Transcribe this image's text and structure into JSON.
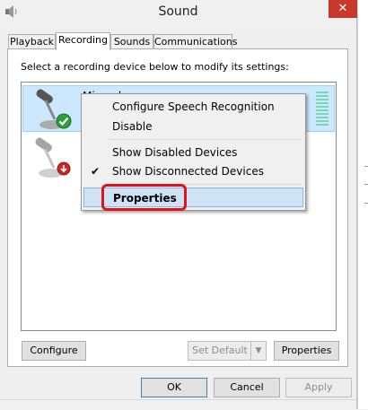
{
  "window": {
    "title": "Sound",
    "close_label": "✕"
  },
  "tabs": [
    {
      "label": "Playback",
      "active": false
    },
    {
      "label": "Recording",
      "active": true
    },
    {
      "label": "Sounds",
      "active": false
    },
    {
      "label": "Communications",
      "active": false
    }
  ],
  "instruction": "Select a recording device below to modify its settings:",
  "devices": [
    {
      "name": "Microphone",
      "icon": "microphone-icon",
      "status": "default-device",
      "selected": true
    },
    {
      "name": "",
      "icon": "microphone-icon",
      "status": "disconnected",
      "selected": false
    }
  ],
  "context_menu": {
    "items": [
      {
        "label": "Configure Speech Recognition",
        "checked": false
      },
      {
        "label": "Disable",
        "checked": false
      },
      {
        "label": "Show Disabled Devices",
        "checked": false
      },
      {
        "label": "Show Disconnected Devices",
        "checked": true
      },
      {
        "label": "Properties",
        "highlighted": true
      }
    ],
    "check_glyph": "✔"
  },
  "buttons": {
    "configure": "Configure",
    "set_default": "Set Default",
    "set_default_arrow": "▼",
    "properties": "Properties",
    "ok": "OK",
    "cancel": "Cancel",
    "apply": "Apply"
  },
  "colors": {
    "selection": "#cce8ff",
    "highlight_border": "#e0121a",
    "close": "#c7392c"
  }
}
